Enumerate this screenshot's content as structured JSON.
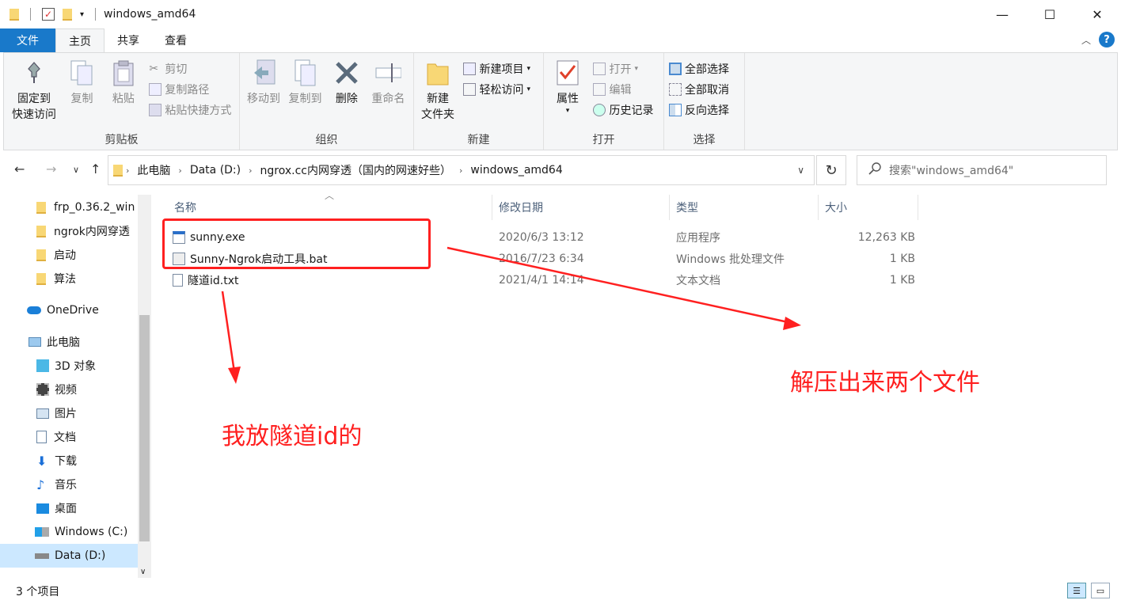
{
  "window": {
    "title": "windows_amd64"
  },
  "tabs": [
    {
      "label": "文件"
    },
    {
      "label": "主页"
    },
    {
      "label": "共享"
    },
    {
      "label": "查看"
    }
  ],
  "ribbon": {
    "clipboard": {
      "group_label": "剪贴板",
      "pin": "固定到\n快速访问",
      "pin_l1": "固定到",
      "pin_l2": "快速访问",
      "copy": "复制",
      "paste": "粘贴",
      "cut": "剪切",
      "copy_path": "复制路径",
      "paste_shortcut": "粘贴快捷方式"
    },
    "organize": {
      "group_label": "组织",
      "move_to": "移动到",
      "copy_to": "复制到",
      "delete": "删除",
      "rename": "重命名"
    },
    "new": {
      "group_label": "新建",
      "new_folder_l1": "新建",
      "new_folder_l2": "文件夹",
      "new_item": "新建项目",
      "easy_access": "轻松访问"
    },
    "open": {
      "group_label": "打开",
      "properties": "属性",
      "open": "打开",
      "edit": "编辑",
      "history": "历史记录"
    },
    "select": {
      "group_label": "选择",
      "select_all": "全部选择",
      "select_none": "全部取消",
      "invert": "反向选择"
    }
  },
  "address": {
    "crumbs": [
      "此电脑",
      "Data (D:)",
      "ngrox.cc内网穿透（国内的网速好些）",
      "windows_amd64"
    ],
    "search_placeholder": "搜索\"windows_amd64\""
  },
  "nav": {
    "items": [
      {
        "label": "frp_0.36.2_win"
      },
      {
        "label": "ngrok内网穿透"
      },
      {
        "label": "启动"
      },
      {
        "label": "算法"
      },
      {
        "label": "OneDrive"
      },
      {
        "label": "此电脑"
      },
      {
        "label": "3D 对象"
      },
      {
        "label": "视频"
      },
      {
        "label": "图片"
      },
      {
        "label": "文档"
      },
      {
        "label": "下载"
      },
      {
        "label": "音乐"
      },
      {
        "label": "桌面"
      },
      {
        "label": "Windows (C:)"
      },
      {
        "label": "Data (D:)"
      }
    ]
  },
  "columns": {
    "name": "名称",
    "date": "修改日期",
    "type": "类型",
    "size": "大小"
  },
  "files": [
    {
      "name": "sunny.exe",
      "date": "2020/6/3 13:12",
      "type": "应用程序",
      "size": "12,263 KB"
    },
    {
      "name": "Sunny-Ngrok启动工具.bat",
      "date": "2016/7/23 6:34",
      "type": "Windows 批处理文件",
      "size": "1 KB"
    },
    {
      "name": "隧道id.txt",
      "date": "2021/4/1 14:14",
      "type": "文本文档",
      "size": "1 KB"
    }
  ],
  "status": {
    "count": "3 个项目"
  },
  "annotations": {
    "two_files": "解压出来两个文件",
    "tunnel_id": "我放隧道id的"
  },
  "colors": {
    "accent": "#1979ca",
    "annotation": "#ff2020",
    "selection": "#cce8ff"
  }
}
